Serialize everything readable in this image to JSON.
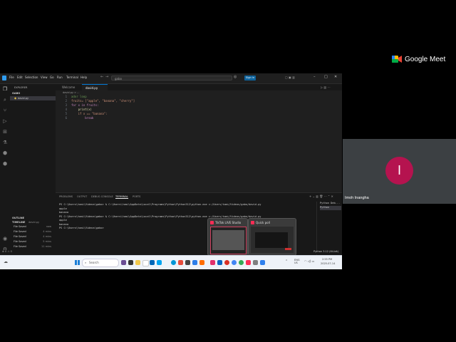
{
  "meet": {
    "brand": "Google Meet",
    "participant_name": "Imoh Inangha",
    "participant_initial": "I",
    "avatar_color": "#b5134f"
  },
  "vscode": {
    "menu": [
      "File",
      "Edit",
      "Selection",
      "View",
      "Go",
      "Run",
      "Terminal",
      "Help"
    ],
    "search_placeholder": "gabo",
    "signin_label": "Sign in",
    "explorer_title": "EXPLORER",
    "folder_name": "GABO",
    "file_item": "david.py",
    "outline_label": "OUTLINE",
    "timeline_label": "TIMELINE",
    "timeline_file": "david.py",
    "timeline": [
      {
        "label": "File Saved",
        "time": "now"
      },
      {
        "label": "File Saved",
        "time": "4 mins"
      },
      {
        "label": "File Saved",
        "time": "4 mins"
      },
      {
        "label": "File Saved",
        "time": "5 mins"
      },
      {
        "label": "File Saved",
        "time": "11 mins"
      }
    ],
    "tabs": [
      "Welcome",
      "david.py"
    ],
    "breadcrumb": "david.py > ...",
    "code_lines": [
      {
        "n": "1",
        "text": "ador loop"
      },
      {
        "n": "2",
        "text": "fruits= [\"apple\", \"banana\", \"cherry\"]"
      },
      {
        "n": "3",
        "text": "for x in fruits:"
      },
      {
        "n": "4",
        "text": "    print(x)"
      },
      {
        "n": "5",
        "text": "    if x == \"banana\":"
      },
      {
        "n": "6",
        "text": "        break"
      }
    ],
    "panel_tabs": [
      "PROBLEMS",
      "OUTPUT",
      "DEBUG CONSOLE",
      "TERMINAL",
      "PORTS"
    ],
    "terminal_lines": [
      "PS C:\\Users\\tomi\\Videos\\gabo> & C:\\Users\\tomi\\AppData\\Local\\Programs\\Python\\Python312\\python.exe c:/Users/tomi/Videos/gabo/david.py",
      "apple",
      "banana",
      "PS C:\\Users\\tomi\\Videos\\gabo> & C:\\Users\\tomi\\AppData\\Local\\Programs\\Python\\Python312\\python.exe c:/Users/tomi/Videos/gabo/david.py",
      "apple",
      "banana",
      "PS C:\\Users\\tomi\\Videos\\gabo> "
    ],
    "terminal_side": [
      "Python Deb...",
      "Python"
    ],
    "status_right": "Python 3.12 (64-bit)"
  },
  "popups": {
    "left_title": "TikTok LIVE Studio",
    "right_title": "Quick poll"
  },
  "taskbar": {
    "search": "Search",
    "lang": "ENG\nUS",
    "time": "2:55 PM",
    "date": "2025-07-14"
  }
}
